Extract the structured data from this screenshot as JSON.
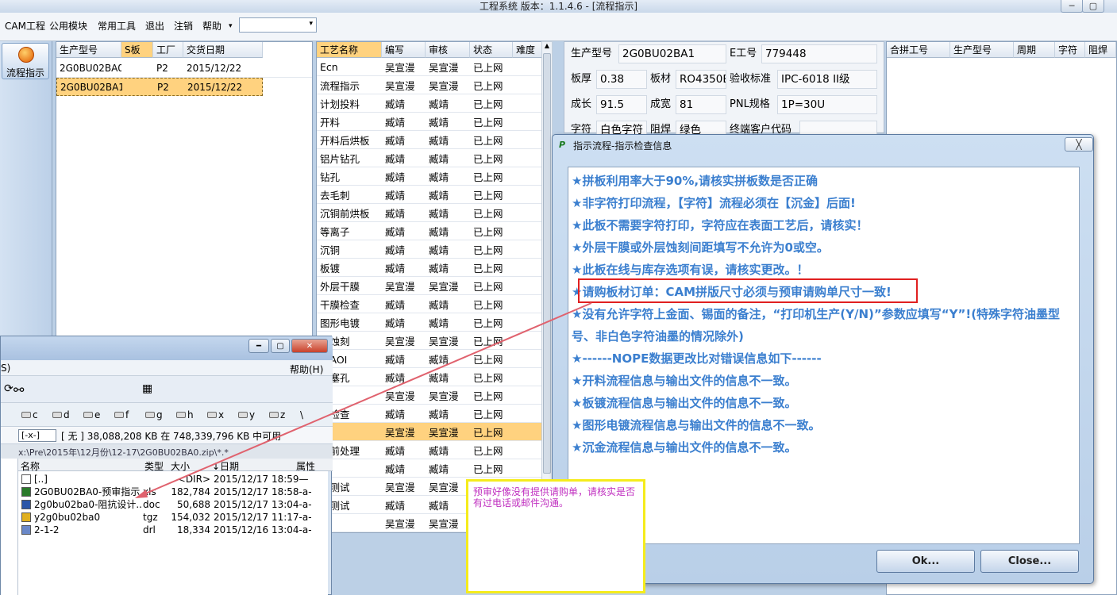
{
  "window": {
    "title": "工程系统  版本：1.1.4.6 - [流程指示]",
    "min_glyph": "─",
    "max_glyph": "▢"
  },
  "menubar": {
    "items": [
      "CAM工程",
      "公用模块",
      "常用工具",
      "退出",
      "注销",
      "帮助"
    ],
    "help_arrow": "▾",
    "combo_value": ""
  },
  "toolbar": {
    "flow_button": "流程指示"
  },
  "products": {
    "headers": [
      "生产型号",
      "S板",
      "工厂",
      "交货日期"
    ],
    "rows": [
      {
        "model": "2G0BU02BA0",
        "s": "",
        "factory": "P2",
        "date": "2015/12/22"
      },
      {
        "model": "2G0BU02BA1",
        "s": "",
        "factory": "P2",
        "date": "2015/12/22"
      }
    ]
  },
  "process": {
    "headers": [
      "工艺名称",
      "编写",
      "审核",
      "状态",
      "难度"
    ],
    "rows": [
      [
        "Ecn",
        "吴宣漫",
        "吴宣漫",
        "已上网"
      ],
      [
        "流程指示",
        "吴宣漫",
        "吴宣漫",
        "已上网"
      ],
      [
        "计划投料",
        "臧靖",
        "臧靖",
        "已上网"
      ],
      [
        "开料",
        "臧靖",
        "臧靖",
        "已上网"
      ],
      [
        "开料后烘板",
        "臧靖",
        "臧靖",
        "已上网"
      ],
      [
        "铝片钻孔",
        "臧靖",
        "臧靖",
        "已上网"
      ],
      [
        "钻孔",
        "臧靖",
        "臧靖",
        "已上网"
      ],
      [
        "去毛刺",
        "臧靖",
        "臧靖",
        "已上网"
      ],
      [
        "沉铜前烘板",
        "臧靖",
        "臧靖",
        "已上网"
      ],
      [
        "等离子",
        "臧靖",
        "臧靖",
        "已上网"
      ],
      [
        "沉铜",
        "臧靖",
        "臧靖",
        "已上网"
      ],
      [
        "板镀",
        "臧靖",
        "臧靖",
        "已上网"
      ],
      [
        "外层干膜",
        "吴宣漫",
        "吴宣漫",
        "已上网"
      ],
      [
        "干膜检查",
        "臧靖",
        "臧靖",
        "已上网"
      ],
      [
        "图形电镀",
        "臧靖",
        "臧靖",
        "已上网"
      ],
      [
        "层蚀刻",
        "吴宣漫",
        "吴宣漫",
        "已上网"
      ],
      [
        "层AOI",
        "臧靖",
        "臧靖",
        "已上网"
      ],
      [
        "焊塞孔",
        "臧靖",
        "臧靖",
        "已上网"
      ],
      [
        "焊",
        "吴宣漫",
        "吴宣漫",
        "已上网"
      ],
      [
        "焊检查",
        "臧靖",
        "臧靖",
        "已上网"
      ],
      [
        "符",
        "吴宣漫",
        "吴宣漫",
        "已上网"
      ],
      [
        "金前处理",
        "臧靖",
        "臧靖",
        "已上网"
      ],
      [
        "金",
        "臧靖",
        "臧靖",
        "已上网"
      ],
      [
        "抗测试",
        "吴宣漫",
        "吴宣漫",
        "已上网"
      ],
      [
        "子测试",
        "臧靖",
        "臧靖",
        "已上网"
      ],
      [
        "板",
        "吴宣漫",
        "吴宣漫",
        "已上网"
      ]
    ]
  },
  "info": {
    "model_label": "生产型号",
    "model": "2G0BU02BA1",
    "eno_label": "E工号",
    "eno": "779448",
    "thick_label": "板厚",
    "thick": "0.38",
    "mat_label": "板材",
    "mat": "RO4350B",
    "std_label": "验收标准",
    "std": "IPC-6018 II级",
    "len_label": "成长",
    "len": "91.5",
    "wid_label": "成宽",
    "wid": "81",
    "pnl_label": "PNL规格",
    "pnl": "1P=30U",
    "char_label": "字符",
    "char": "白色字符",
    "mask_label": "阻焊",
    "mask": "绿色",
    "cust_label": "终端客户代码"
  },
  "merge": {
    "headers": [
      "合拼工号",
      "生产型号",
      "周期",
      "字符",
      "阻焊"
    ]
  },
  "dialog": {
    "title": "指示流程-指示检查信息",
    "icon": "P",
    "close": "╳",
    "messages": [
      "★拼板利用率大于90%,请核实拼板数是否正确",
      "★非字符打印流程，【字符】流程必须在【沉金】后面!",
      "★此板不需要字符打印，字符应在表面工艺后，请核实！",
      "★外层干膜或外层蚀刻间距填写不允许为0或空。",
      "★此板在线与库存选项有误，请核实更改。！",
      "★请购板材订单：CAM拼版尺寸必须与预审请购单尺寸一致!",
      "★没有允许字符上金面、锡面的备注，“打印机生产(Y/N)”参数应填写“Y”!(特殊字符油墨型号、非白色字符油墨的情况除外)",
      "★------NOPE数据更改比对错误信息如下------",
      "★开料流程信息与输出文件的信息不一致。",
      "★板镀流程信息与输出文件的信息不一致。",
      "★图形电镀流程信息与输出文件的信息不一致。",
      "★沉金流程信息与输出文件的信息不一致。"
    ],
    "ok": "Ok...",
    "cancel": "Close..."
  },
  "filemgr": {
    "menu_left": "S)",
    "menu_help": "帮助(H)",
    "drives": [
      "c",
      "d",
      "e",
      "f",
      "g",
      "h",
      "x",
      "y",
      "z",
      "\\"
    ],
    "drive_combo": "[-x-]",
    "space_info": "[ 无 ]  38,088,208 KB 在 748,339,796 KB 中可用",
    "path": "x:\\Pre\\2015年\\12月份\\12-17\\2G0BU02BA0.zip\\*.*",
    "col_name": "名称",
    "col_type": "类型",
    "col_size": "大小",
    "col_date": "↓日期",
    "col_attr": "属性",
    "files": [
      {
        "name": "[..]",
        "type": "",
        "size": "<DIR>",
        "date": "2015/12/17 18:59—"
      },
      {
        "name": "2G0BU02BA0-预审指示",
        "type": "xls",
        "size": "182,784",
        "date": "2015/12/17 18:58-a-"
      },
      {
        "name": "2g0bu02ba0-阻抗设计...",
        "type": "doc",
        "size": "50,688",
        "date": "2015/12/17 13:04-a-"
      },
      {
        "name": "y2g0bu02ba0",
        "type": "tgz",
        "size": "154,032",
        "date": "2015/12/17 11:17-a-"
      },
      {
        "name": "2-1-2",
        "type": "drl",
        "size": "18,334",
        "date": "2015/12/16 13:04-a-"
      }
    ]
  },
  "note": {
    "text": "预审好像没有提供请购单，请核实是否有过电话或邮件沟通。"
  },
  "colors": {
    "accent": "#3b7fcf",
    "selected": "#ffd27f",
    "highlight": "#e02020",
    "note_border": "#f5ec1c",
    "note_text": "#c030c0"
  }
}
